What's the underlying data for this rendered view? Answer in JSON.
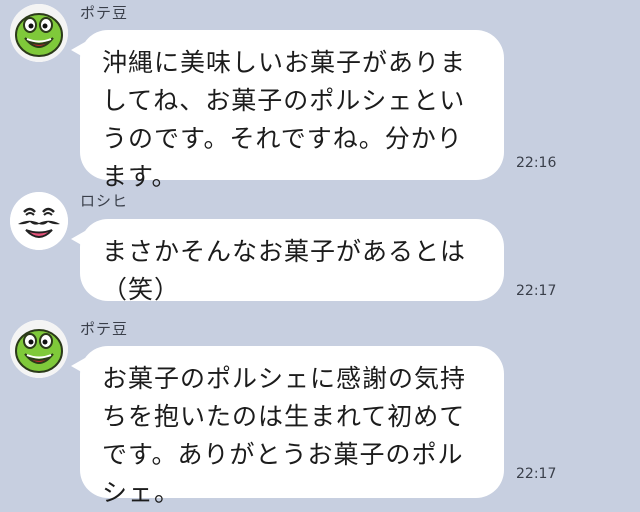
{
  "messages": [
    {
      "sender": "ポテ豆",
      "avatar_icon": "green-frog-character-icon",
      "text": "沖縄に美味しいお菓子がありま\nしてね、お菓子のポルシェとい\nうのです。それですね。分かり\nます。",
      "time": "22:16"
    },
    {
      "sender": "ロシヒ",
      "avatar_icon": "mustached-face-icon",
      "text": "まさかそんなお菓子があるとは\n（笑）",
      "time": "22:17"
    },
    {
      "sender": "ポテ豆",
      "avatar_icon": "green-frog-character-icon",
      "text": "お菓子のポルシェに感謝の気持\nちを抱いたのは生まれて初めて\nです。ありがとうお菓子のポル\nシェ。",
      "time": "22:17"
    }
  ],
  "colors": {
    "background": "#c7cfe0",
    "bubble": "#ffffff",
    "avatar_green": "#7fc93a"
  }
}
